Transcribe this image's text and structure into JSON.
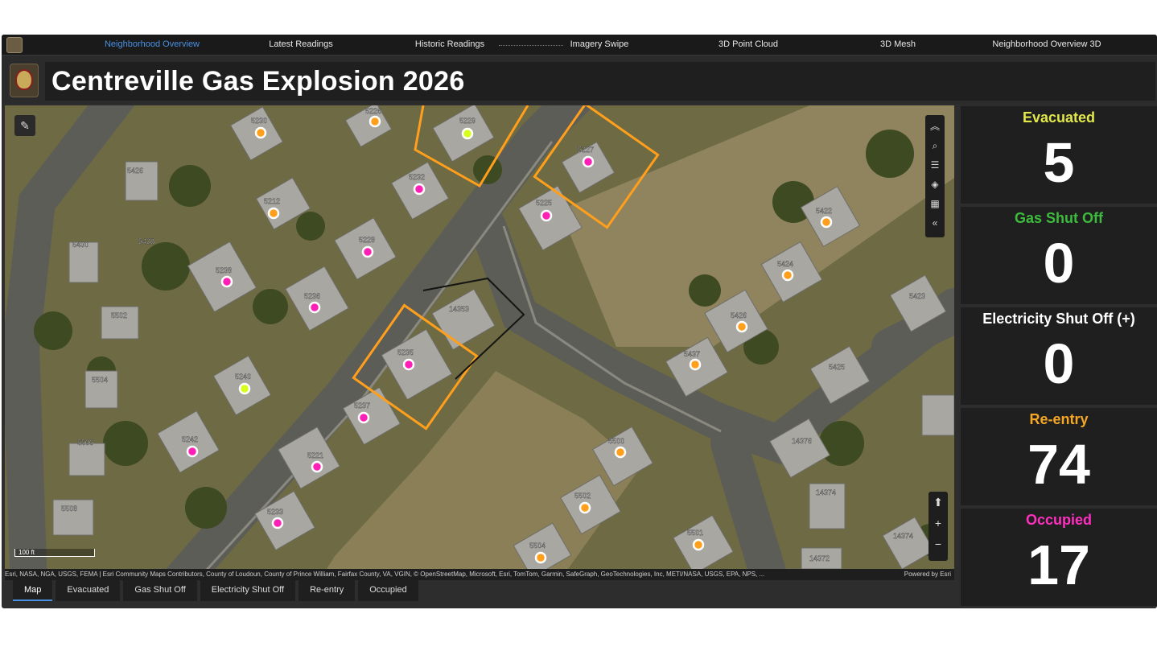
{
  "nav": {
    "items": [
      {
        "label": "Neighborhood Overview",
        "active": true
      },
      {
        "label": "Latest Readings",
        "active": false
      },
      {
        "label": "Historic Readings",
        "active": false
      },
      {
        "label": "Imagery Swipe",
        "active": false
      },
      {
        "label": "3D Point Cloud",
        "active": false
      },
      {
        "label": "3D Mesh",
        "active": false
      },
      {
        "label": "Neighborhood Overview 3D",
        "active": false
      }
    ]
  },
  "header": {
    "title": "Centreville Gas Explosion 2026",
    "logo_icon": "county-seal-icon"
  },
  "map": {
    "scale_label": "100 ft",
    "attribution": "Esri, NASA, NGA, USGS, FEMA | Esri Community Maps Contributors, County of Loudoun, County of Prince William, Fairfax County, VA, VGIN, © OpenStreetMap, Microsoft, Esri, TomTom, Garmin, SafeGraph, GeoTechnologies, Inc, METI/NASA, USGS, EPA, NPS, ...",
    "powered_by": "Powered by Esri",
    "tools": [
      "collapse-up-icon",
      "search-icon",
      "legend-icon",
      "layers-icon",
      "basemap-icon",
      "collapse-left-icon"
    ],
    "zoom": [
      "compass-icon",
      "zoom-in-icon",
      "zoom-out-icon"
    ],
    "legend_colors": {
      "evacuated": "#d7ff1e",
      "reentry": "#ff9f1c",
      "occupied": "#ff1fb6",
      "incident_outline": "#ff9f1c"
    },
    "house_labels": [
      "5230",
      "5226",
      "5212",
      "5228",
      "5232",
      "5229",
      "5227",
      "5221",
      "5422",
      "5424",
      "5238",
      "5236",
      "5502",
      "5426",
      "5500",
      "5504",
      "5240",
      "5235",
      "14353",
      "5237",
      "5242",
      "5233",
      "5506",
      "5508",
      "5225",
      "5501",
      "14372",
      "14374",
      "5423",
      "5425",
      "14376",
      "5503"
    ]
  },
  "tabs": [
    {
      "label": "Map",
      "active": true
    },
    {
      "label": "Evacuated",
      "active": false
    },
    {
      "label": "Gas Shut Off",
      "active": false
    },
    {
      "label": "Electricity Shut Off",
      "active": false
    },
    {
      "label": "Re-entry",
      "active": false
    },
    {
      "label": "Occupied",
      "active": false
    }
  ],
  "stats": [
    {
      "label": "Evacuated",
      "value": "5",
      "color": "#e2e84a"
    },
    {
      "label": "Gas Shut Off",
      "value": "0",
      "color": "#3dbb3d"
    },
    {
      "label": "Electricity Shut Off (+)",
      "value": "0",
      "color": "#ffffff"
    },
    {
      "label": "Re-entry",
      "value": "74",
      "color": "#f5a623"
    },
    {
      "label": "Occupied",
      "value": "17",
      "color": "#ff2fbf"
    }
  ]
}
